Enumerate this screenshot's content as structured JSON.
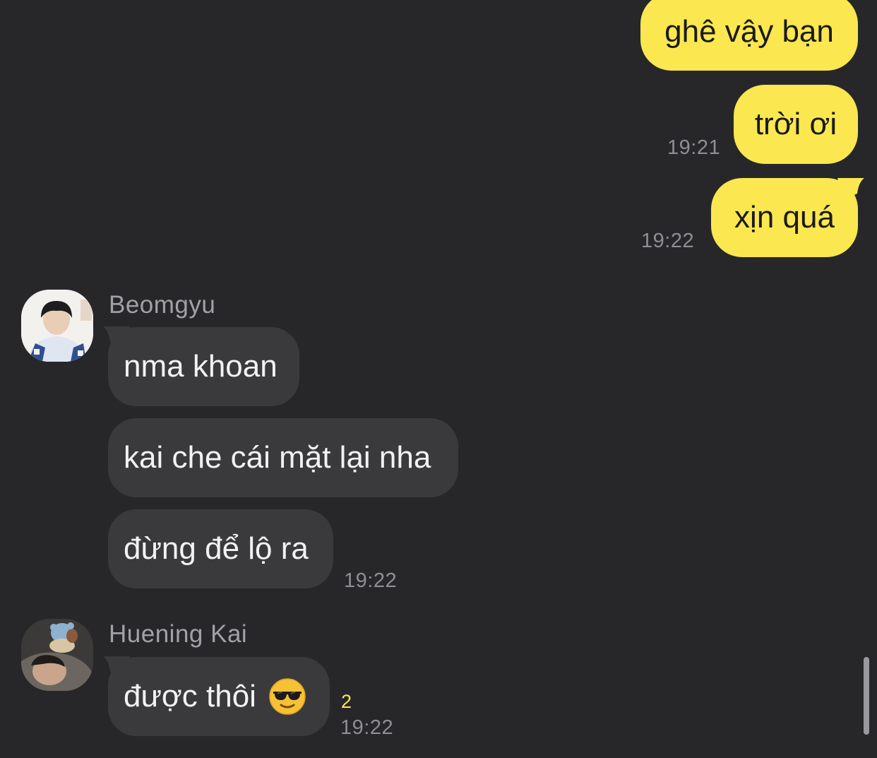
{
  "messages_out": [
    {
      "text": "ghê vậy bạn"
    },
    {
      "text": "trời ơi",
      "time": "19:21"
    },
    {
      "text": "xịn quá",
      "time": "19:22"
    }
  ],
  "group_beomgyu": {
    "sender": "Beomgyu",
    "messages": [
      {
        "text": "nma khoan"
      },
      {
        "text": "kai che cái mặt lại nha"
      },
      {
        "text": "đừng để lộ ra",
        "time": "19:22"
      }
    ]
  },
  "group_kai": {
    "sender": "Huening Kai",
    "messages": [
      {
        "text": "được thôi",
        "emoji": "sunglasses-emoji-icon",
        "unread": "2",
        "time": "19:22"
      }
    ]
  },
  "colors": {
    "background": "#27272a",
    "my_bubble": "#fbe74f",
    "their_bubble": "#3a3a3c",
    "unread_count": "#fbe74f"
  }
}
